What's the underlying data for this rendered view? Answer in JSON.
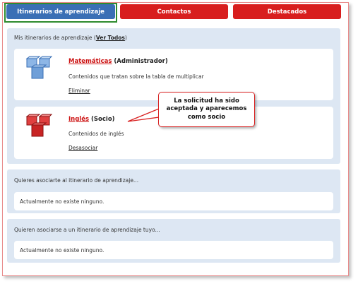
{
  "tabs": [
    {
      "label": "Itinerarios de aprendizaje",
      "active": true
    },
    {
      "label": "Contactos",
      "active": false
    },
    {
      "label": "Destacados",
      "active": false
    }
  ],
  "my_itineraries": {
    "title_prefix": "Mis itinerarios de aprendizaje (",
    "view_all": "Ver Todos",
    "title_suffix": ")",
    "items": [
      {
        "name": "Matemáticas",
        "role": "(Administrador)",
        "description": "Contenidos que tratan sobre la tabla de multiplicar",
        "action": "Eliminar",
        "icon": "blue-cubes-icon"
      },
      {
        "name": "Inglés",
        "role": "(Socio)",
        "description": "Contenidos de inglés",
        "action": "Desasociar",
        "icon": "red-cubes-icon"
      }
    ]
  },
  "callout": {
    "line1": "La solicitud ha sido",
    "line2": "aceptada y aparecemos",
    "line3": "como socio"
  },
  "want_to_join": {
    "title": "Quieres asociarte al itinerario de aprendizaje...",
    "empty": "Actualmente no existe ninguno."
  },
  "others_want": {
    "title": "Quieren asociarse a un itinerario de aprendizaje tuyo...",
    "empty": "Actualmente no existe ninguno."
  },
  "colors": {
    "tab_active": "#3a6fb5",
    "tab_inactive": "#d81e1e",
    "panel_bg": "#dde7f3",
    "link_red": "#cc1111",
    "highlight_green": "#2e8b2e"
  }
}
